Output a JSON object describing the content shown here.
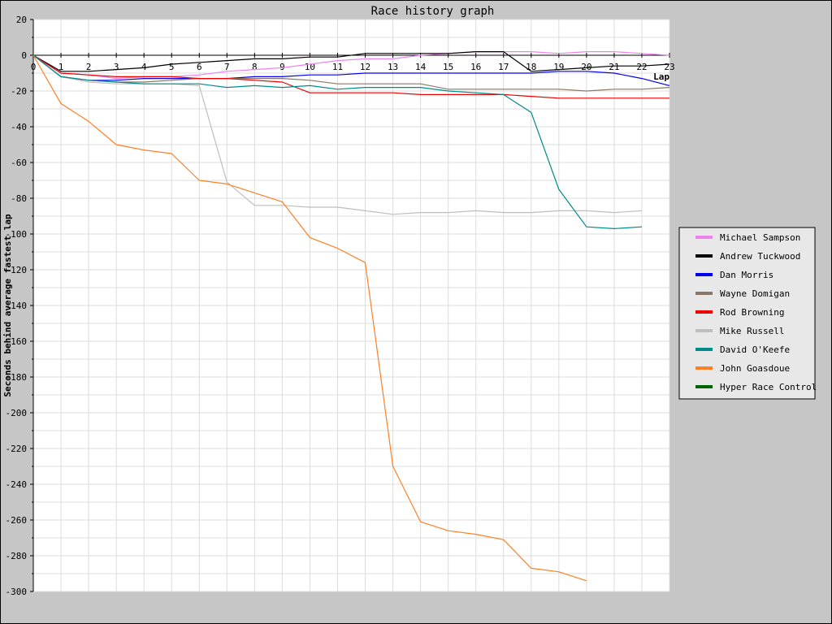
{
  "chart_data": {
    "type": "line",
    "title": "Race history graph",
    "xlabel": "Lap",
    "ylabel": "Seconds behind average fastest lap",
    "xlim": [
      0,
      23
    ],
    "ylim": [
      -300,
      20
    ],
    "xticks": [
      0,
      1,
      2,
      3,
      4,
      5,
      6,
      7,
      8,
      9,
      10,
      11,
      12,
      13,
      14,
      15,
      16,
      17,
      18,
      19,
      20,
      21,
      22,
      23
    ],
    "yticks": [
      20,
      0,
      -20,
      -40,
      -60,
      -80,
      -100,
      -120,
      -140,
      -160,
      -180,
      -200,
      -220,
      -240,
      -260,
      -280,
      -300
    ],
    "grid": true,
    "legend_position": "right",
    "series": [
      {
        "name": "Michael Sampson",
        "color": "#ee82ee",
        "x": [
          0,
          1,
          2,
          3,
          4,
          5,
          6,
          7,
          8,
          9,
          10,
          11,
          12,
          13,
          14,
          15,
          16,
          17,
          18,
          19,
          20,
          21,
          22,
          23
        ],
        "y": [
          0,
          -10,
          -11,
          -13,
          -12,
          -12,
          -11,
          -9,
          -8,
          -7,
          -5,
          -3,
          -2,
          -2,
          0,
          1,
          2,
          2,
          2,
          1,
          2,
          2,
          1,
          0
        ]
      },
      {
        "name": "Andrew Tuckwood",
        "color": "#000000",
        "x": [
          0,
          1,
          2,
          3,
          4,
          5,
          6,
          7,
          8,
          9,
          10,
          11,
          12,
          13,
          14,
          15,
          16,
          17,
          18,
          19,
          20,
          21,
          22,
          23
        ],
        "y": [
          0,
          -9,
          -9,
          -8,
          -7,
          -5,
          -4,
          -3,
          -2,
          -2,
          -1,
          -1,
          1,
          1,
          1,
          1,
          2,
          2,
          -9,
          -8,
          -7,
          -6,
          -6,
          -5
        ]
      },
      {
        "name": "Dan Morris",
        "color": "#0000ee",
        "x": [
          0,
          1,
          2,
          3,
          4,
          5,
          6,
          7,
          8,
          9,
          10,
          11,
          12,
          13,
          14,
          15,
          16,
          17,
          18,
          19,
          20,
          21,
          22,
          23
        ],
        "y": [
          0,
          -12,
          -14,
          -14,
          -13,
          -13,
          -13,
          -13,
          -12,
          -12,
          -11,
          -11,
          -10,
          -10,
          -10,
          -10,
          -10,
          -10,
          -10,
          -9,
          -9,
          -10,
          -13,
          -17
        ]
      },
      {
        "name": "Wayne Domigan",
        "color": "#8b7765",
        "x": [
          0,
          1,
          2,
          3,
          4,
          5,
          6,
          7,
          8,
          9,
          10,
          11,
          12,
          13,
          14,
          15,
          16,
          17,
          18,
          19,
          20,
          21,
          22,
          23
        ],
        "y": [
          0,
          -12,
          -14,
          -15,
          -15,
          -14,
          -13,
          -13,
          -13,
          -13,
          -14,
          -16,
          -16,
          -16,
          -16,
          -19,
          -19,
          -19,
          -19,
          -19,
          -20,
          -19,
          -19,
          -18
        ]
      },
      {
        "name": "Rod Browning",
        "color": "#ee0000",
        "x": [
          0,
          1,
          2,
          3,
          4,
          5,
          6,
          7,
          8,
          9,
          10,
          11,
          12,
          13,
          14,
          15,
          16,
          17,
          18,
          19,
          20,
          21,
          22,
          23
        ],
        "y": [
          0,
          -10,
          -11,
          -12,
          -12,
          -12,
          -13,
          -13,
          -14,
          -15,
          -21,
          -21,
          -21,
          -21,
          -22,
          -22,
          -22,
          -22,
          -23,
          -24,
          -24,
          -24,
          -24,
          -24
        ]
      },
      {
        "name": "Mike Russell",
        "color": "#bebebe",
        "x": [
          0,
          1,
          2,
          3,
          4,
          5,
          6,
          7,
          8,
          9,
          10,
          11,
          12,
          13,
          14,
          15,
          16,
          17,
          18,
          19,
          20,
          21,
          22
        ],
        "y": [
          0,
          -12,
          -15,
          -16,
          -16,
          -16,
          -17,
          -71,
          -84,
          -84,
          -85,
          -85,
          -87,
          -89,
          -88,
          -88,
          -87,
          -88,
          -88,
          -87,
          -87,
          -88,
          -87
        ]
      },
      {
        "name": "David O'Keefe",
        "color": "#008b8b",
        "x": [
          0,
          1,
          2,
          3,
          4,
          5,
          6,
          7,
          8,
          9,
          10,
          11,
          12,
          13,
          14,
          15,
          16,
          17,
          18,
          19,
          20,
          21,
          22
        ],
        "y": [
          0,
          -12,
          -14,
          -15,
          -16,
          -16,
          -16,
          -18,
          -17,
          -18,
          -17,
          -19,
          -18,
          -18,
          -18,
          -20,
          -21,
          -22,
          -32,
          -75,
          -96,
          -97,
          -96
        ]
      },
      {
        "name": "John Goasdoue",
        "color": "#ff7f24",
        "x": [
          0,
          1,
          2,
          3,
          4,
          5,
          6,
          7,
          8,
          9,
          10,
          11,
          12,
          13,
          14,
          15,
          16,
          17,
          18,
          19,
          20
        ],
        "y": [
          0,
          -27,
          -37,
          -50,
          -53,
          -55,
          -70,
          -72,
          -77,
          -82,
          -102,
          -108,
          -116,
          -230,
          -261,
          -266,
          -268,
          -271,
          -287,
          -289,
          -294
        ]
      },
      {
        "name": "Hyper Race Control",
        "color": "#006400",
        "x": [],
        "y": []
      }
    ]
  }
}
